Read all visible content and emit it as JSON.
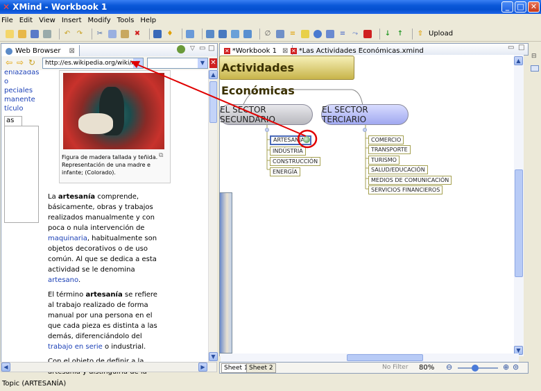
{
  "window": {
    "title": "XMind - Workbook 1",
    "logo": "xmind-logo-icon"
  },
  "menu": [
    "File",
    "Edit",
    "View",
    "Insert",
    "Modify",
    "Tools",
    "Help"
  ],
  "toolbar": {
    "upload_label": "Upload"
  },
  "browser": {
    "tab_label": "Web Browser",
    "tab_close": "⊠",
    "url": "http://es.wikipedia.org/wiki/Artes",
    "sidebar_links": [
      "enlazadas",
      "o",
      "peciales",
      "manente",
      "tículo"
    ],
    "sidebar_tab": "as",
    "caption": "Figura de madera tallada y teñida. Representación de una madre e infante; (Colorado).",
    "para1": {
      "pre": "La ",
      "bold": "artesanía",
      "mid": " comprende, básicamente, obras y trabajos realizados manualmente y con poca o nula intervención de ",
      "link1": "maquinaria",
      "mid2": ", habitualmente son objetos decorativos o de uso común. Al que se dedica a esta actividad se le denomina ",
      "link2": "artesano",
      "end": "."
    },
    "para2": {
      "pre": "El término ",
      "bold": "artesanía",
      "mid": " se refiere al trabajo realizado de forma manual por una persona en el que cada pieza es distinta a las demás, diferenciándolo del ",
      "link1": "trabajo en serie",
      "end": " o industrial."
    },
    "para3": "Con el objeto de definir a la artesanía y distinguirla de la"
  },
  "editor": {
    "tabs": [
      "*Workbook 1",
      "*Las Actividades Económicas.xmind"
    ],
    "tab_close": "⊠",
    "main_topic": "Actividades Económicas",
    "branches": [
      {
        "label": "EL SECTOR SECUNDARIO",
        "subtopics": [
          "ARTESANÍA",
          "INDÚSTRIA",
          "CONSTRUCCIÓN",
          "ENERGÍA"
        ]
      },
      {
        "label": "EL SECTOR TERCIARIO",
        "subtopics": [
          "COMERCIO",
          "TRANSPORTE",
          "TURISMO",
          "SALUD/EDUCACIÓN",
          "MEDIOS DE COMUNICACIÓN",
          "SERVICIOS FINANCIEROS"
        ]
      }
    ],
    "sheets": [
      "Sheet 1",
      "Sheet 2"
    ],
    "filter": "No Filter",
    "zoom": "80%"
  },
  "status": {
    "text": "Topic (ARTESANÍA)"
  },
  "colors": {
    "titlebar": "#0a58d8",
    "sector_secundario": "#c8c8cc",
    "sector_terciario": "#b4b8f4",
    "highlight": "#e00000"
  }
}
